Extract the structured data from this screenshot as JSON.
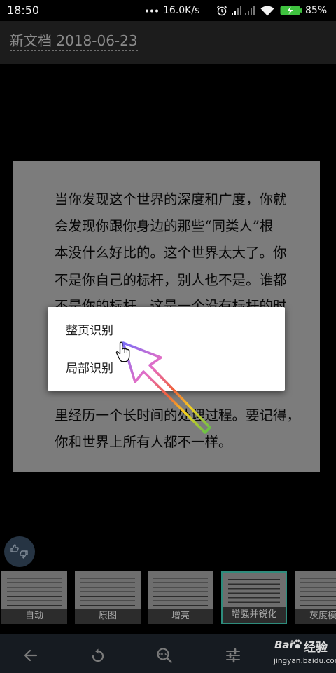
{
  "status_bar": {
    "time": "18:50",
    "network_speed": "16.0K/s",
    "battery_percent": "85%",
    "icons": [
      "notification-dots-icon",
      "alarm-icon",
      "signal-icon",
      "signal-icon",
      "wifi-icon",
      "battery-icon"
    ]
  },
  "header": {
    "title": "新文档 2018-06-23"
  },
  "document": {
    "lines": [
      "当你发现这个世界的深度和广度，你就",
      "会发现你跟你身边的那些“同类人”根",
      "本没什么好比的。这个世界太大了。你",
      "不是你自己的标杆，别人也不是。谁都",
      "不是你的标杆，这是一个没有标杆的时",
      "里经历一个长时间的处理过程。要记得，",
      "你和世界上所有人都不一样。"
    ]
  },
  "popup_menu": {
    "items": [
      {
        "label": "整页识别"
      },
      {
        "label": "局部识别"
      }
    ]
  },
  "feedback_button": {
    "icon": "thumbs-up-down-icon"
  },
  "filters": [
    {
      "label": "自动",
      "selected": false
    },
    {
      "label": "原图",
      "selected": false
    },
    {
      "label": "增亮",
      "selected": false
    },
    {
      "label": "增强并锐化",
      "selected": true
    },
    {
      "label": "灰度模",
      "selected": false
    }
  ],
  "toolbar": {
    "buttons": [
      {
        "icon": "back-arrow-icon"
      },
      {
        "icon": "rotate-icon"
      },
      {
        "icon": "ocr-search-icon",
        "label": "OCR"
      },
      {
        "icon": "adjust-sliders-icon"
      }
    ]
  },
  "watermark": {
    "brand": "Bai",
    "name": "经验",
    "url": "jingyan.baidu.com",
    "icon": "baidu-paw-icon"
  },
  "annotation": {
    "icons": [
      "rainbow-arrow-icon",
      "hand-cursor-icon"
    ]
  },
  "colors": {
    "selected_border": "#2e8c7c",
    "battery": "#3fc23f",
    "popup_background": "#ffffff",
    "toolbar_background": "#161b21"
  }
}
